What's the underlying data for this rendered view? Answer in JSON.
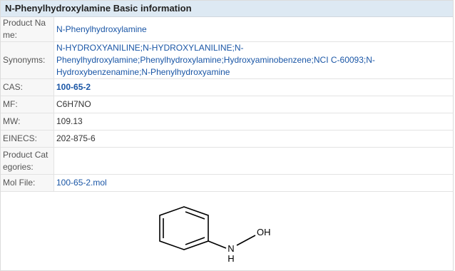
{
  "header": {
    "title": "N-Phenylhydroxylamine Basic information"
  },
  "rows": {
    "product_name": {
      "label": "Product Na me:",
      "value": "N-Phenylhydroxylamine"
    },
    "synonyms": {
      "label": "Synonyms:",
      "value": "N-HYDROXYANILINE;N-HYDROXYLANILINE;N-Phenylhydroxylamine;Phenylhydroxylamine;Hydroxyaminobenzene;NCI C-60093;N-Hydroxybenzenamine;N-Phenylhydroxyamine"
    },
    "cas": {
      "label": "CAS:",
      "value": "100-65-2"
    },
    "mf": {
      "label": "MF:",
      "value": "C6H7NO"
    },
    "mw": {
      "label": "MW:",
      "value": "109.13"
    },
    "einecs": {
      "label": "EINECS:",
      "value": "202-875-6"
    },
    "product_categories": {
      "label": "Product Cat egories:",
      "value": ""
    },
    "mol_file": {
      "label": "Mol File:",
      "value": "100-65-2.mol"
    }
  },
  "structure": {
    "atom_oh": "OH",
    "atom_n": "N",
    "atom_h": "H"
  }
}
